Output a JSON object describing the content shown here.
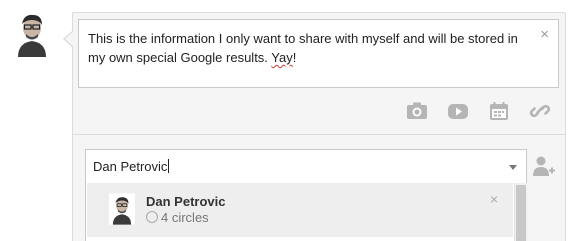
{
  "post": {
    "text_main": "This is the information I only want to share with myself and will be stored in my own special Google results. ",
    "text_misspelled": "Yay",
    "text_end": "!",
    "close_glyph": "×"
  },
  "attachments": {
    "icons": [
      "camera-icon",
      "video-icon",
      "event-icon",
      "link-icon"
    ]
  },
  "share": {
    "input_value": "Dan Petrovic"
  },
  "suggestion": {
    "name": "Dan Petrovic",
    "circles": "4 circles",
    "close_glyph": "×"
  },
  "colors": {
    "card_bg": "#f5f5f5",
    "border": "#c9c9c9",
    "icon_gray": "#b5b5b5",
    "highlight_bg": "#eeeeee",
    "spell_underline": "#d23b3b"
  }
}
